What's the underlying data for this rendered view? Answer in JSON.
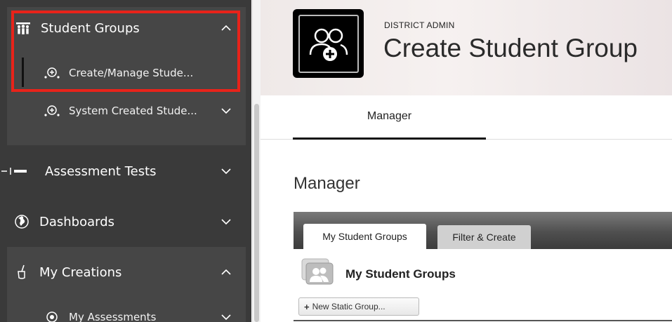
{
  "sidebar": {
    "student_groups": {
      "label": "Student Groups",
      "icon": "student-groups-icon",
      "expanded": true
    },
    "create_manage": {
      "label": "Create/Manage Stude..."
    },
    "system_created": {
      "label": "System Created Stude..."
    },
    "assessment_tests": {
      "label": "Assessment Tests"
    },
    "dashboards": {
      "label": "Dashboards"
    },
    "my_creations": {
      "label": "My Creations",
      "expanded": true
    },
    "my_assessments": {
      "label": "My Assessments"
    }
  },
  "header": {
    "kicker": "DISTRICT ADMIN",
    "title": "Create Student Group"
  },
  "tabs": {
    "manager": "Manager"
  },
  "main": {
    "section_title": "Manager",
    "panel_tabs": [
      "My Student Groups",
      "Filter & Create"
    ],
    "group_title": "My Student Groups",
    "new_button": "New Static Group...",
    "new_button_symbol": "+"
  },
  "colors": {
    "sidebar_bg": "#3a3a3a",
    "sidebar_block": "#464646",
    "highlight": "#e8231a"
  }
}
